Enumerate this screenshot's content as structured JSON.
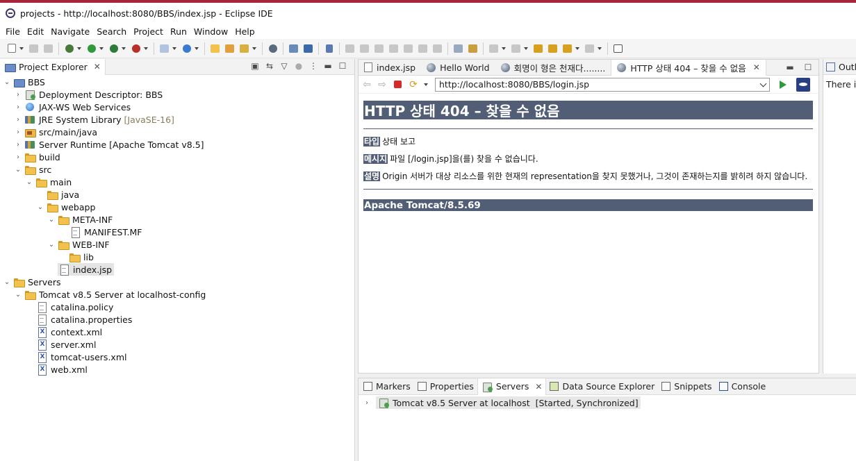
{
  "window": {
    "title": "projects - http://localhost:8080/BBS/index.jsp - Eclipse IDE"
  },
  "menu": [
    "File",
    "Edit",
    "Navigate",
    "Search",
    "Project",
    "Run",
    "Window",
    "Help"
  ],
  "explorer": {
    "title": "Project Explorer",
    "tree": [
      {
        "label": "BBS",
        "icon": "project-icon",
        "expanded": true
      },
      {
        "label": "Deployment Descriptor: BBS",
        "icon": "deployment-descriptor-icon"
      },
      {
        "label": "JAX-WS Web Services",
        "icon": "web-services-icon"
      },
      {
        "label": "JRE System Library",
        "decoration": "[JavaSE-16]",
        "icon": "library-icon"
      },
      {
        "label": "src/main/java",
        "icon": "source-folder-icon"
      },
      {
        "label": "Server Runtime [Apache Tomcat v8.5]",
        "icon": "library-icon"
      },
      {
        "label": "build",
        "icon": "folder-icon"
      },
      {
        "label": "src",
        "icon": "folder-icon",
        "expanded": true
      },
      {
        "label": "main",
        "icon": "folder-icon",
        "expanded": true
      },
      {
        "label": "java",
        "icon": "folder-icon"
      },
      {
        "label": "webapp",
        "icon": "folder-icon",
        "expanded": true
      },
      {
        "label": "META-INF",
        "icon": "folder-icon",
        "expanded": true
      },
      {
        "label": "MANIFEST.MF",
        "icon": "file-icon"
      },
      {
        "label": "WEB-INF",
        "icon": "folder-icon",
        "expanded": true
      },
      {
        "label": "lib",
        "icon": "folder-icon"
      },
      {
        "label": "index.jsp",
        "icon": "jsp-file-icon",
        "selected": true
      },
      {
        "label": "Servers",
        "icon": "folder-icon",
        "expanded": true
      },
      {
        "label": "Tomcat v8.5 Server at localhost-config",
        "icon": "folder-icon",
        "expanded": true
      },
      {
        "label": "catalina.policy",
        "icon": "file-icon"
      },
      {
        "label": "catalina.properties",
        "icon": "file-icon"
      },
      {
        "label": "context.xml",
        "icon": "xml-file-icon"
      },
      {
        "label": "server.xml",
        "icon": "xml-file-icon"
      },
      {
        "label": "tomcat-users.xml",
        "icon": "xml-file-icon"
      },
      {
        "label": "web.xml",
        "icon": "xml-file-icon"
      }
    ]
  },
  "editor": {
    "tabs": [
      {
        "label": "index.jsp",
        "icon": "jsp-file-icon"
      },
      {
        "label": "Hello World",
        "icon": "globe-icon"
      },
      {
        "label": "회명이 형은 천재다........",
        "icon": "globe-icon"
      },
      {
        "label": "HTTP 상태 404 – 찾을 수 없음",
        "icon": "globe-icon",
        "active": true
      }
    ],
    "url": "http://localhost:8080/BBS/login.jsp",
    "page": {
      "heading": "HTTP 상태 404 – 찾을 수 없음",
      "type_label": "타입",
      "type_text": "상태 보고",
      "message_label": "메시지",
      "message_text": "파일 [/login.jsp]을(를) 찾을 수 없습니다.",
      "desc_label": "설명",
      "desc_text": "Origin 서버가 대상 리소스를 위한 현재의 representation을 찾지 못했거나, 그것이 존재하는지를 밝히려 하지 않습니다.",
      "footer": "Apache Tomcat/8.5.69"
    }
  },
  "outline": {
    "title": "Outli",
    "body": "There is"
  },
  "bottom": {
    "tabs": [
      {
        "label": "Markers"
      },
      {
        "label": "Properties"
      },
      {
        "label": "Servers",
        "active": true
      },
      {
        "label": "Data Source Explorer"
      },
      {
        "label": "Snippets"
      },
      {
        "label": "Console"
      }
    ],
    "server_name": "Tomcat v8.5 Server at localhost",
    "server_status": "[Started, Synchronized]"
  },
  "colors": {
    "tomcat_header": "#525d76",
    "accent_bar": "#a8243a"
  }
}
